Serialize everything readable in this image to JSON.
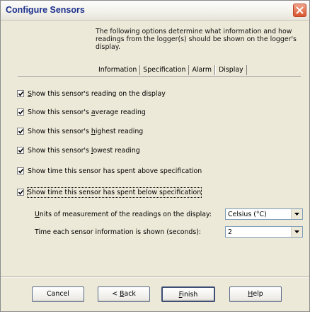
{
  "window": {
    "title": "Configure Sensors"
  },
  "intro": "The following options determine what information and how readings from the logger(s) should be shown on the logger's display.",
  "tabs": [
    {
      "label": "Information"
    },
    {
      "label": "Specification"
    },
    {
      "label": "Alarm"
    },
    {
      "label": "Display",
      "active": true
    }
  ],
  "checkboxes": [
    {
      "pre": "",
      "key": "S",
      "post": "how this sensor's reading on the display",
      "checked": true
    },
    {
      "pre": "Show this sensor's ",
      "key": "a",
      "post": "verage reading",
      "checked": true
    },
    {
      "pre": "Show this sensor's ",
      "key": "h",
      "post": "ighest reading",
      "checked": true
    },
    {
      "pre": "Show this sensor's ",
      "key": "l",
      "post": "owest reading",
      "checked": true
    },
    {
      "pre": "Show time this sensor has spent above specification",
      "key": "",
      "post": "",
      "checked": true
    },
    {
      "pre": "Show time this sensor has spent below specification",
      "key": "",
      "post": "",
      "checked": true
    }
  ],
  "fields": {
    "units": {
      "pre": "",
      "key": "U",
      "post": "nits of measurement of the readings on the display:",
      "value": "Celsius (°C)"
    },
    "time": {
      "pre": "Time each sensor information is shown (seconds):",
      "key": "",
      "post": "",
      "value": "2"
    }
  },
  "buttons": {
    "cancel": "Cancel",
    "back": {
      "pre": "< ",
      "key": "B",
      "post": "ack"
    },
    "finish": {
      "pre": "",
      "key": "F",
      "post": "inish"
    },
    "help": {
      "pre": "",
      "key": "H",
      "post": "elp"
    }
  },
  "colors": {
    "title_text": "#1b2f8c",
    "close_button": "#d9532e",
    "dialog_bg": "#ece9d8"
  },
  "icons": {
    "close": "close-x-icon",
    "check": "checkmark-icon",
    "dropdown": "chevron-down-icon"
  }
}
